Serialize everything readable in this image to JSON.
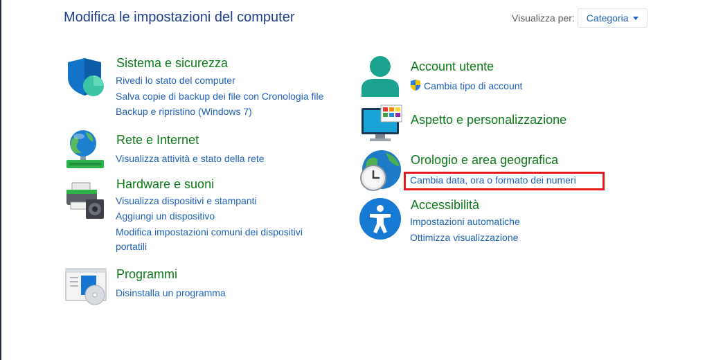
{
  "header": {
    "title": "Modifica le impostazioni del computer",
    "view_by_label": "Visualizza per:",
    "view_by_value": "Categoria"
  },
  "categories": {
    "system": {
      "title": "Sistema e sicurezza",
      "links": [
        "Rivedi lo stato del computer",
        "Salva copie di backup dei file con Cronologia file",
        "Backup e ripristino (Windows 7)"
      ],
      "icon": "shield-icon"
    },
    "network": {
      "title": "Rete e Internet",
      "links": [
        "Visualizza attività e stato della rete"
      ],
      "icon": "globe-network-icon"
    },
    "hardware": {
      "title": "Hardware e suoni",
      "links": [
        "Visualizza dispositivi e stampanti",
        "Aggiungi un dispositivo",
        "Modifica impostazioni comuni dei dispositivi",
        "portatili"
      ],
      "icon": "printer-speaker-icon"
    },
    "programs": {
      "title": "Programmi",
      "links": [
        "Disinstalla un programma"
      ],
      "icon": "programs-icon"
    },
    "accounts": {
      "title": "Account utente",
      "links": [
        "Cambia tipo di account"
      ],
      "icon": "user-icon"
    },
    "appearance": {
      "title": "Aspetto e personalizzazione",
      "links": [],
      "icon": "monitor-icon"
    },
    "clock": {
      "title": "Orologio e area geografica",
      "links": [
        "Cambia data, ora o formato dei numeri"
      ],
      "icon": "clock-globe-icon"
    },
    "accessibility": {
      "title": "Accessibilità",
      "links": [
        "Impostazioni automatiche",
        "Ottimizza visualizzazione"
      ],
      "icon": "accessibility-icon"
    }
  },
  "colors": {
    "title_blue": "#1e3f8f",
    "category_green": "#0d7a1a",
    "link_blue": "#1e60b8",
    "highlight_red": "#e41b1b"
  }
}
